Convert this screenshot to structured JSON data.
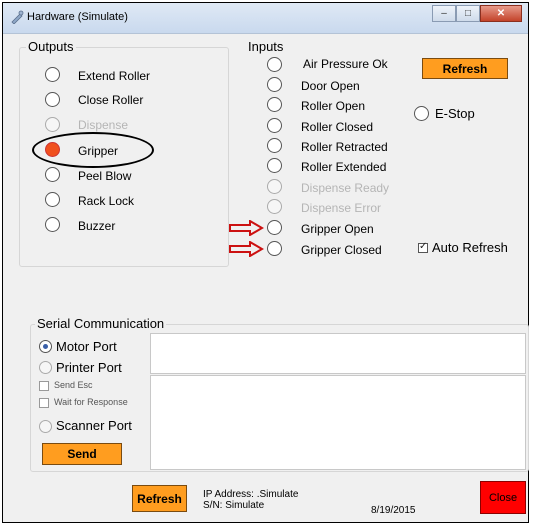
{
  "window": {
    "title": "Hardware (Simulate)"
  },
  "outputs": {
    "legend": "Outputs",
    "items": [
      {
        "label": "Extend Roller",
        "state": "off",
        "enabled": true
      },
      {
        "label": "Close Roller",
        "state": "off",
        "enabled": true
      },
      {
        "label": "Dispense",
        "state": "off",
        "enabled": false
      },
      {
        "label": "Gripper",
        "state": "on",
        "enabled": true
      },
      {
        "label": "Peel Blow",
        "state": "off",
        "enabled": true
      },
      {
        "label": "Rack Lock",
        "state": "off",
        "enabled": true
      },
      {
        "label": "Buzzer",
        "state": "off",
        "enabled": true
      }
    ]
  },
  "inputs": {
    "legend": "Inputs",
    "items": [
      {
        "label": "Air Pressure Ok",
        "enabled": true
      },
      {
        "label": "Door Open",
        "enabled": true
      },
      {
        "label": "Roller Open",
        "enabled": true
      },
      {
        "label": "Roller Closed",
        "enabled": true
      },
      {
        "label": "Roller Retracted",
        "enabled": true
      },
      {
        "label": "Roller Extended",
        "enabled": true
      },
      {
        "label": "Dispense Ready",
        "enabled": false
      },
      {
        "label": "Dispense Error",
        "enabled": false
      },
      {
        "label": "Gripper Open",
        "enabled": true
      },
      {
        "label": "Gripper Closed",
        "enabled": true
      }
    ],
    "estop_label": "E-Stop",
    "refresh_label": "Refresh",
    "auto_refresh_label": "Auto Refresh",
    "auto_refresh_checked": true
  },
  "serial": {
    "legend": "Serial Communication",
    "motor_port": "Motor Port",
    "printer_port": "Printer Port",
    "send_esc": "Send Esc",
    "wait_for_response": "Wait for Response",
    "scanner_port": "Scanner Port",
    "send_label": "Send",
    "selected_port": "Motor Port"
  },
  "footer": {
    "refresh_label": "Refresh",
    "ip_address": "IP Address: .Simulate",
    "sn": "S/N: Simulate",
    "date": "8/19/2015",
    "close_label": "Close"
  },
  "colors": {
    "accent_orange": "#ff9d1f",
    "close_red": "#ff0000",
    "active_radio": "#f0501e",
    "annotation_arrow": "#cc1111"
  }
}
